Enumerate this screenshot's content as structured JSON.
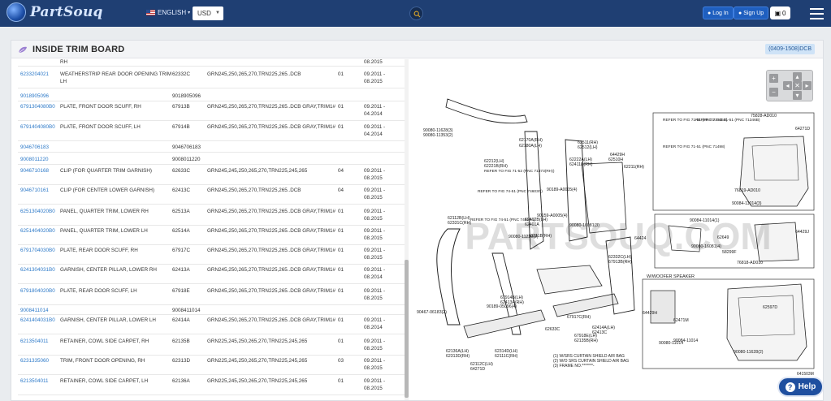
{
  "header": {
    "logo_text": "PartSouq",
    "language": "ENGLISH",
    "currency": "USD",
    "login_label": "Log In",
    "signup_label": "Sign Up",
    "cart_count": "0",
    "colors": {
      "bar": "#1f3f73",
      "accent_button": "#1f5fbf"
    }
  },
  "panel": {
    "title": "INSIDE TRIM BOARD",
    "code": "(0409-1508)DCB"
  },
  "rows": [
    {
      "num": "",
      "name": "RH",
      "code": "",
      "model": "",
      "qty": "",
      "date": "08.2015"
    },
    {
      "num": "6233204021",
      "name": "WEATHERSTRIP REAR DOOR OPENING TRIM LH",
      "code": "62332C",
      "model": "GRN245,250,265,270,TRN225,265..DCB",
      "qty": "01",
      "date": "09.2011 - 08.2015"
    },
    {
      "num": "9018905096",
      "name": "",
      "code": "9018905096",
      "model": "",
      "qty": "",
      "date": ""
    },
    {
      "num": "6791304080B0",
      "name": "PLATE, FRONT DOOR SCUFF, RH",
      "code": "67913B",
      "model": "GRN245,250,265,270,TRN225,265..DCB GRAY,TRIM1#",
      "qty": "01",
      "date": "09.2011 - 04.2014"
    },
    {
      "num": "6791404080B0",
      "name": "PLATE, FRONT DOOR SCUFF, LH",
      "code": "67914B",
      "model": "GRN245,250,265,270,TRN225,265..DCB GRAY,TRIM1#",
      "qty": "01",
      "date": "09.2011 - 04.2014"
    },
    {
      "num": "9046706183",
      "name": "",
      "code": "9046706183",
      "model": "",
      "qty": "",
      "date": ""
    },
    {
      "num": "9008011220",
      "name": "",
      "code": "9008011220",
      "model": "",
      "qty": "",
      "date": ""
    },
    {
      "num": "9046710168",
      "name": "CLIP (FOR QUARTER TRIM GARNISH)",
      "code": "62633C",
      "model": "GRN245,245,250,265,270,TRN225,245,265",
      "qty": "04",
      "date": "09.2011 - 08.2015"
    },
    {
      "num": "9046710161",
      "name": "CLIP (FOR CENTER LOWER GARNISH)",
      "code": "62413C",
      "model": "GRN245,250,265,270,TRN225,265..DCB",
      "qty": "04",
      "date": "09.2011 - 08.2015"
    },
    {
      "num": "6251304020B0",
      "name": "PANEL, QUARTER TRIM, LOWER RH",
      "code": "62513A",
      "model": "GRN245,250,265,270,TRN225,265..DCB GRAY,TRIM1#",
      "qty": "01",
      "date": "09.2011 - 08.2015"
    },
    {
      "num": "6251404020B0",
      "name": "PANEL, QUARTER TRIM, LOWER LH",
      "code": "62514A",
      "model": "GRN245,250,265,270,TRN225,265..DCB GRAY,TRIM1#",
      "qty": "01",
      "date": "09.2011 - 08.2015"
    },
    {
      "num": "6791704030B0",
      "name": "PLATE, REAR DOOR SCUFF, RH",
      "code": "67917C",
      "model": "GRN245,250,265,270,TRN225,265..DCB GRAY,TRIM1#",
      "qty": "01",
      "date": "09.2011 - 08.2015"
    },
    {
      "num": "6241304031B0",
      "name": "GARNISH, CENTER PILLAR, LOWER RH",
      "code": "62413A",
      "model": "GRN245,250,265,270,TRN225,265..DCB GRAY,TRIM1#",
      "qty": "01",
      "date": "09.2011 - 08.2014"
    },
    {
      "num": "6791804020B0",
      "name": "PLATE, REAR DOOR SCUFF, LH",
      "code": "67918E",
      "model": "GRN245,250,265,270,TRN225,265..DCB GRAY,TRIM1#",
      "qty": "01",
      "date": "09.2011 - 08.2015"
    },
    {
      "num": "9008411014",
      "name": "",
      "code": "9008411014",
      "model": "",
      "qty": "",
      "date": ""
    },
    {
      "num": "6241404031B0",
      "name": "GARNISH, CENTER PILLAR, LOWER LH",
      "code": "62414A",
      "model": "GRN245,250,265,270,TRN225,265..DCB GRAY,TRIM1#",
      "qty": "01",
      "date": "09.2011 - 08.2014"
    },
    {
      "num": "6213504011",
      "name": "RETAINER, COWL SIDE CARPET, RH",
      "code": "62135B",
      "model": "GRN225,245,250,265,270,TRN225,245,265",
      "qty": "01",
      "date": "09.2011 - 08.2015"
    },
    {
      "num": "6231335060",
      "name": "TRIM, FRONT DOOR OPENING, RH",
      "code": "62313D",
      "model": "GRN225,245,250,265,270,TRN225,245,265",
      "qty": "03",
      "date": "09.2011 - 08.2015"
    },
    {
      "num": "6213504011",
      "name": "RETAINER, COWL SIDE CARPET, LH",
      "code": "62136A",
      "model": "GRN225,245,250,265,270,TRN225,245,265",
      "qty": "01",
      "date": "09.2011 - 08.2015"
    }
  ],
  "diagram": {
    "watermark": "PARTSOUQ.COM",
    "figure_id": "641503M",
    "woofer_label": "W/WOOFER SPEAKER",
    "notes": [
      "(1) W/SRS CURTAIN SHIELD AIR BAG",
      "(2) W/O SRS CURTAIN SHIELD AIR BAG",
      "(3) FRAME NO.*******-"
    ],
    "refer_labels": [
      "REFER TO FIG 71-51 (PNC 71345B)",
      "REFER TO FIG 71-51 (PNC 71346B)",
      "REFER TO FIG 71-51 (PNC 71498)",
      "REFER TO FIG 71-52 (PNC 71373(RH))",
      "REFER TO FIG 74-51 (PNC 74603C)",
      "REFER TO FIG 74-51 (PNC 74617A)"
    ],
    "part_labels": [
      "62170A(RH)",
      "62180A(LH)",
      "62511(RH)",
      "62512(LH)",
      "64429H",
      "62510H",
      "62211(RH)",
      "62212(LH)",
      "62221B(RH)",
      "62222A(LH)",
      "62411B(RH)",
      "62412B(LH)",
      "62401A",
      "62111B(RH)",
      "62112B(LH)",
      "62331C(RH)",
      "62332C(LH)",
      "67913B(RH)",
      "67914B(LH)",
      "62413A(RH)",
      "62414A(LH)",
      "62413C",
      "62633C",
      "67917C(RH)",
      "67918E(LH)",
      "62135B(RH)",
      "62136A(LH)",
      "62313D(RH)",
      "62314D(LH)",
      "62111C(RH)",
      "62112C(LH)",
      "64271D",
      "64271D",
      "64429J",
      "64424",
      "62649",
      "58299F",
      "64429H",
      "62471M",
      "62597D",
      "90080-11628(2)",
      "90080-11628(3)",
      "90080-11353(2)",
      "90189-A0005(4)",
      "90159-A0005(4)",
      "90080-11220(2)",
      "90467-06183(2)",
      "90189-05096(4)",
      "90080-16081(3)",
      "90084-11014(1)",
      "90084-11014(3)",
      "90080-16081(4)",
      "90084-11014",
      "75828-AD010",
      "76819-AD010",
      "76818-AD010",
      "90080-11014"
    ]
  },
  "help_label": "Help"
}
